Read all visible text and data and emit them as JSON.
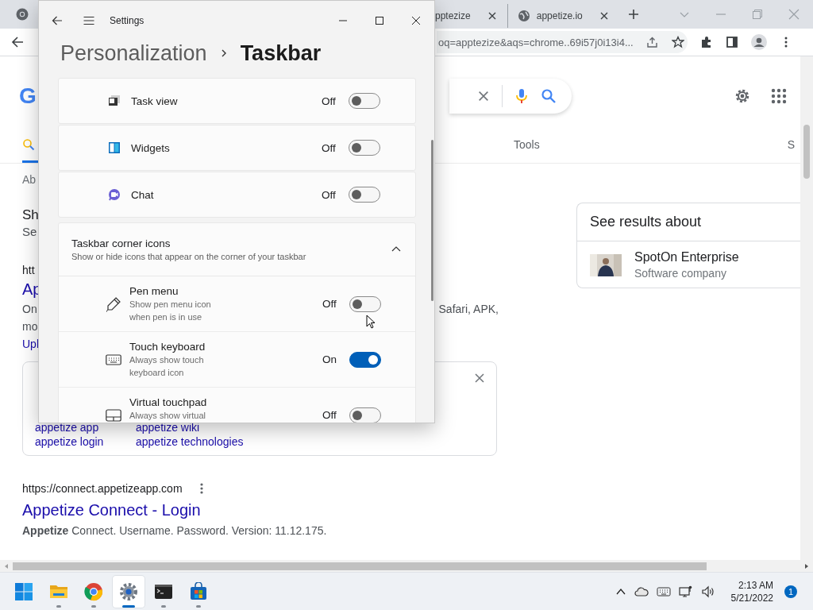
{
  "browser": {
    "tabs": [
      {
        "title": "pptezize",
        "selected": false
      },
      {
        "title": "appetize.io",
        "selected": false
      }
    ],
    "address": "oq=apptezize&aqs=chrome..69i57j0i13i4...",
    "page": {
      "logo_fragment": "G",
      "search_tabs": [
        {
          "kind": "icon",
          "selected": true
        },
        {
          "kind": "text",
          "label": "Tools",
          "selected": false
        },
        {
          "kind": "text",
          "label": "S",
          "selected": false
        }
      ],
      "about": "Ab",
      "heading": {
        "title": "Sh",
        "subtitle": "Se"
      },
      "result_1": {
        "url": "htt",
        "title": "Ap",
        "snippet": [
          {
            "left": "On",
            "right": "Safari, APK,"
          },
          {
            "left": "mo"
          }
        ],
        "sitelink": "Upl"
      },
      "related": {
        "rows": [
          {
            "links": [
              "appetize app",
              "appetize wiki"
            ]
          },
          {
            "links": [
              "appetize login",
              "appetize technologies"
            ]
          }
        ]
      },
      "result_2": {
        "url": "https://connect.appetizeapp.com",
        "title": "Appetize Connect - Login",
        "snippet": "**Appetize** Connect. Username. Password. Version: 11.12.175."
      },
      "knowledge": {
        "title": "See results about",
        "entity": "SpotOn Enterprise",
        "type": "Software company"
      }
    }
  },
  "settings": {
    "title": "Settings",
    "breadcrumb": {
      "parent": "Personalization",
      "current": "Taskbar"
    },
    "items": [
      {
        "label": "Task view",
        "status": "Off",
        "on": false
      },
      {
        "label": "Widgets",
        "status": "Off",
        "on": false
      },
      {
        "label": "Chat",
        "status": "Off",
        "on": false
      }
    ],
    "section": {
      "title": "Taskbar corner icons",
      "description": "Show or hide icons that appear on the corner of your taskbar",
      "expanded": true,
      "items": [
        {
          "label": "Pen menu",
          "description": "Show pen menu icon when pen is in use",
          "status": "Off",
          "on": false
        },
        {
          "label": "Touch keyboard",
          "description": "Always show touch keyboard icon",
          "status": "On",
          "on": true
        },
        {
          "label": "Virtual touchpad",
          "description": "Always show virtual",
          "status": "Off",
          "on": false
        }
      ]
    }
  },
  "taskbar": {
    "apps": [
      {
        "running": false,
        "selected": false
      },
      {
        "running": true,
        "selected": false
      },
      {
        "running": true,
        "selected": false
      },
      {
        "running": true,
        "selected": true
      },
      {
        "running": true,
        "selected": false
      },
      {
        "running": true,
        "selected": false
      }
    ],
    "time": "2:13 AM",
    "date": "5/21/2022",
    "notifications": "1"
  }
}
